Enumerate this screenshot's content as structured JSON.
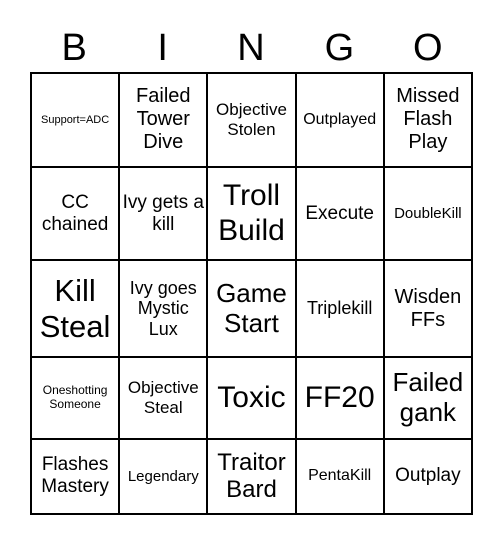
{
  "header": [
    "B",
    "I",
    "N",
    "G",
    "O"
  ],
  "cells": [
    [
      "Support=ADC",
      "Failed Tower Dive",
      "Objective Stolen",
      "Outplayed",
      "Missed Flash Play"
    ],
    [
      "CC chained",
      "Ivy gets a kill",
      "Troll Build",
      "Execute",
      "DoubleKill"
    ],
    [
      "Kill Steal",
      "Ivy goes Mystic Lux",
      "Game Start",
      "Triplekill",
      "Wisden FFs"
    ],
    [
      "Oneshotting Someone",
      "Objective Steal",
      "Toxic",
      "FF20",
      "Failed gank"
    ],
    [
      "Flashes Mastery",
      "Legendary",
      "Traitor Bard",
      "PentaKill",
      "Outplay"
    ]
  ]
}
